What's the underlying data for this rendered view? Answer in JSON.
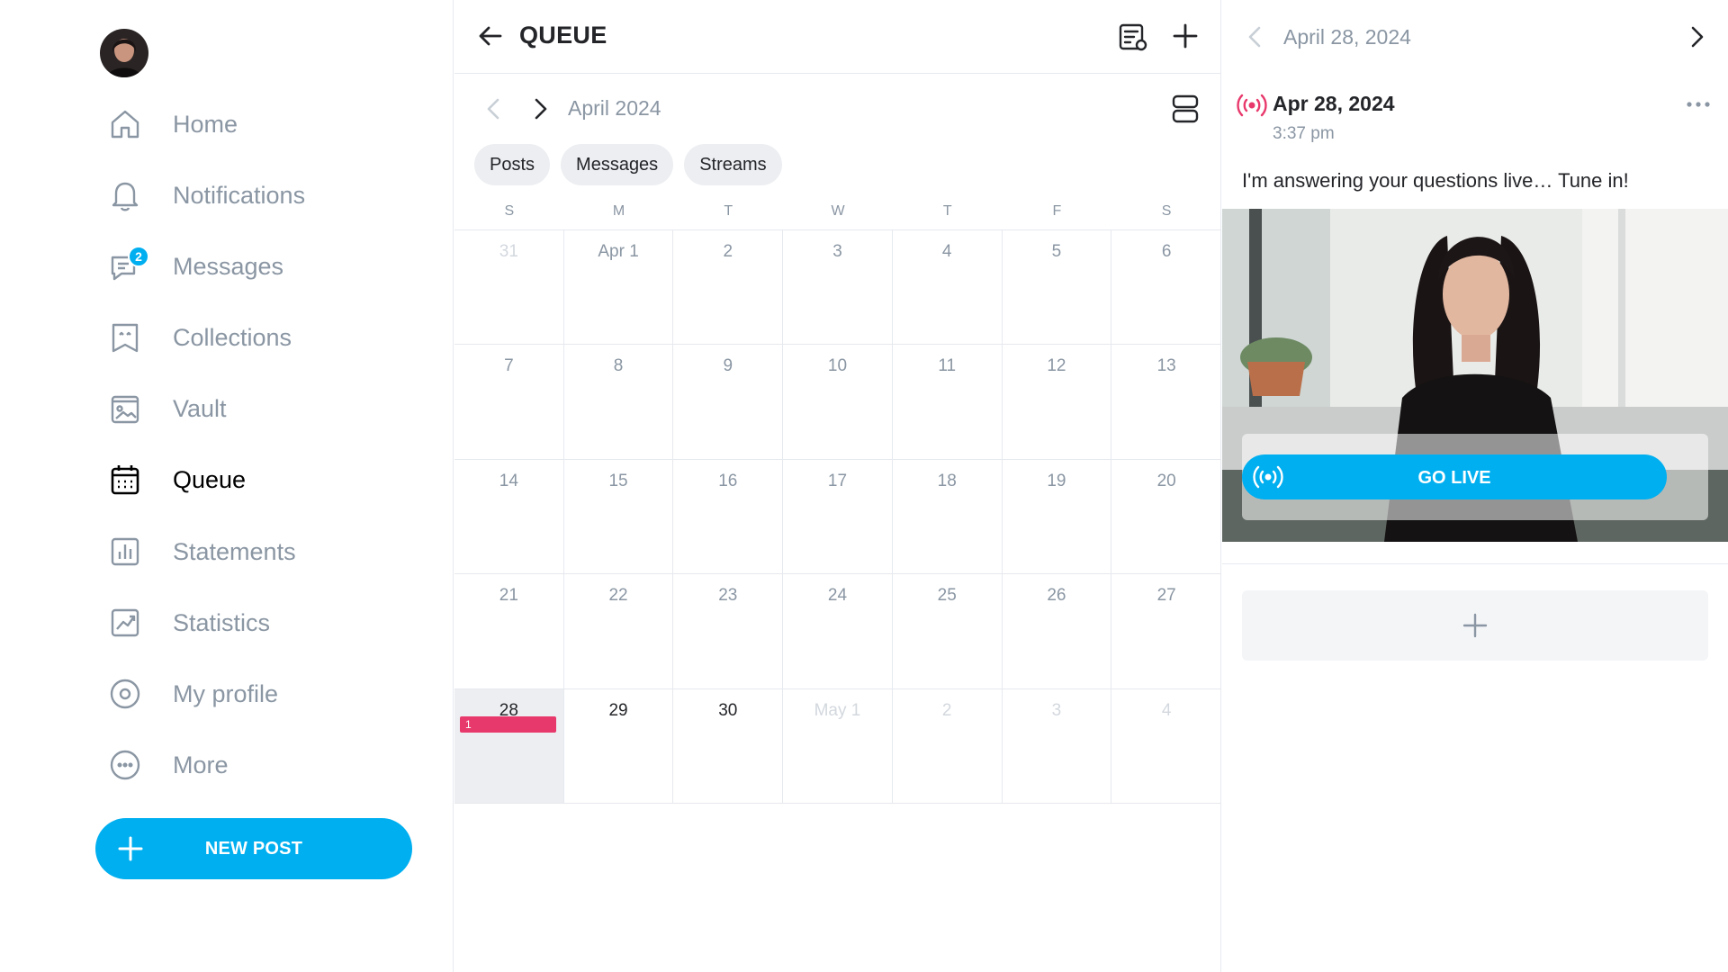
{
  "sidebar": {
    "items": [
      {
        "label": "Home",
        "icon": "home-icon"
      },
      {
        "label": "Notifications",
        "icon": "bell-icon"
      },
      {
        "label": "Messages",
        "icon": "chat-icon",
        "badge": "2"
      },
      {
        "label": "Collections",
        "icon": "bookmark-icon"
      },
      {
        "label": "Vault",
        "icon": "image-vault-icon"
      },
      {
        "label": "Queue",
        "icon": "calendar-icon",
        "active": true
      },
      {
        "label": "Statements",
        "icon": "bar-chart-icon"
      },
      {
        "label": "Statistics",
        "icon": "line-chart-icon"
      },
      {
        "label": "My profile",
        "icon": "profile-icon"
      },
      {
        "label": "More",
        "icon": "more-icon"
      }
    ],
    "new_post_label": "NEW POST"
  },
  "queue": {
    "title": "QUEUE",
    "month_label": "April 2024",
    "filters": [
      "Posts",
      "Messages",
      "Streams"
    ],
    "weekdays": [
      "S",
      "M",
      "T",
      "W",
      "T",
      "F",
      "S"
    ],
    "weeks": [
      [
        {
          "d": "31",
          "s": "faded"
        },
        {
          "d": "Apr 1",
          "s": "normal"
        },
        {
          "d": "2",
          "s": "normal"
        },
        {
          "d": "3",
          "s": "normal"
        },
        {
          "d": "4",
          "s": "normal"
        },
        {
          "d": "5",
          "s": "normal"
        },
        {
          "d": "6",
          "s": "normal"
        }
      ],
      [
        {
          "d": "7",
          "s": "normal"
        },
        {
          "d": "8",
          "s": "normal"
        },
        {
          "d": "9",
          "s": "normal"
        },
        {
          "d": "10",
          "s": "normal"
        },
        {
          "d": "11",
          "s": "normal"
        },
        {
          "d": "12",
          "s": "normal"
        },
        {
          "d": "13",
          "s": "normal"
        }
      ],
      [
        {
          "d": "14",
          "s": "normal"
        },
        {
          "d": "15",
          "s": "normal"
        },
        {
          "d": "16",
          "s": "normal"
        },
        {
          "d": "17",
          "s": "normal"
        },
        {
          "d": "18",
          "s": "normal"
        },
        {
          "d": "19",
          "s": "normal"
        },
        {
          "d": "20",
          "s": "normal"
        }
      ],
      [
        {
          "d": "21",
          "s": "normal"
        },
        {
          "d": "22",
          "s": "normal"
        },
        {
          "d": "23",
          "s": "normal"
        },
        {
          "d": "24",
          "s": "normal"
        },
        {
          "d": "25",
          "s": "normal"
        },
        {
          "d": "26",
          "s": "normal"
        },
        {
          "d": "27",
          "s": "normal"
        }
      ],
      [
        {
          "d": "28",
          "s": "selected",
          "event": "1"
        },
        {
          "d": "29",
          "s": "dark"
        },
        {
          "d": "30",
          "s": "dark"
        },
        {
          "d": "May 1",
          "s": "faded"
        },
        {
          "d": "2",
          "s": "faded"
        },
        {
          "d": "3",
          "s": "faded"
        },
        {
          "d": "4",
          "s": "faded"
        }
      ]
    ]
  },
  "detail": {
    "date_label": "April 28, 2024",
    "post_date": "Apr 28, 2024",
    "post_time": "3:37 pm",
    "post_text": "I'm answering your questions live… Tune in!",
    "go_live_label": "GO LIVE"
  },
  "colors": {
    "accent": "#00aff0",
    "event": "#e8396c",
    "muted_text": "#8a96a3",
    "selected_day_bg": "#eceef1"
  }
}
